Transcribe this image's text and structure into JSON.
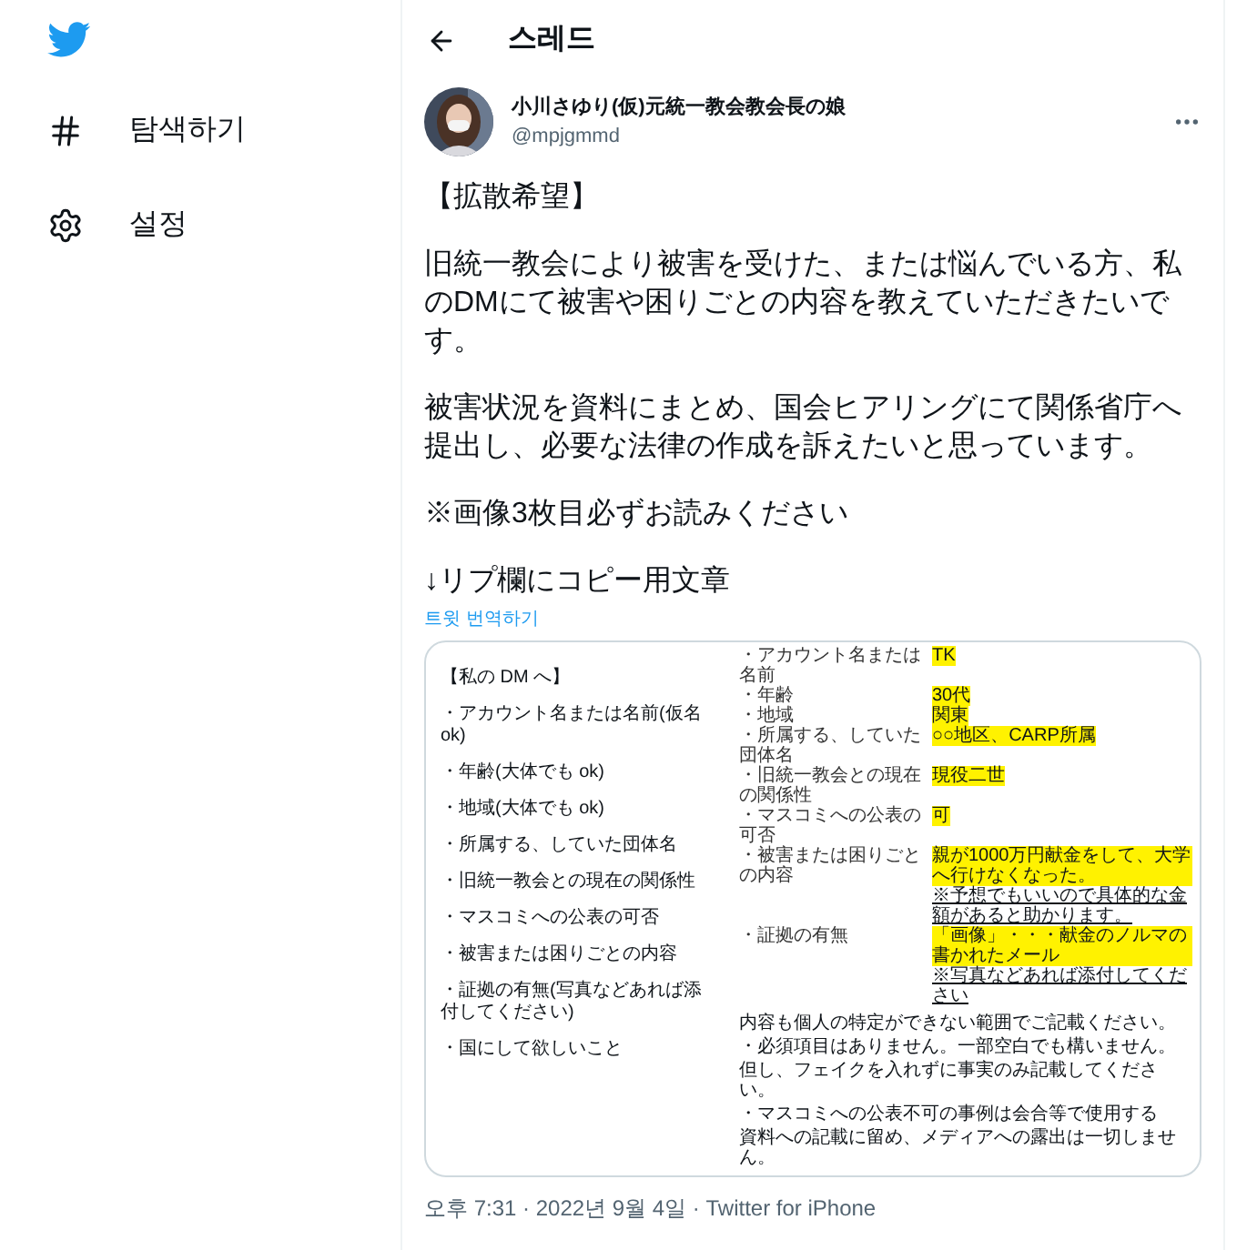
{
  "sidebar": {
    "items": [
      {
        "kind": "explore",
        "label": "탐색하기"
      },
      {
        "kind": "settings",
        "label": "설정"
      }
    ]
  },
  "header": {
    "title": "스레드"
  },
  "tweet": {
    "author": {
      "name": "小川さゆり(仮)元統一教会教会長の娘",
      "handle": "@mpjgmmd"
    },
    "paragraphs": [
      "【拡散希望】",
      "旧統一教会により被害を受けた、または悩んでいる方、私のDMにて被害や困りごとの内容を教えていただきたいです。",
      "被害状況を資料にまとめ、国会ヒアリングにて関係省庁へ提出し、必要な法律の作成を訴えたいと思っています。",
      "※画像3枚目必ずお読みください",
      "↓リプ欄にコピー用文章"
    ],
    "translate_link": "트윗 번역하기",
    "images": {
      "left": {
        "heading": "【私の DM へ】",
        "items": [
          "・アカウント名または名前(仮名 ok)",
          "・年齢(大体でも ok)",
          "・地域(大体でも ok)",
          "・所属する、していた団体名",
          "・旧統一教会との現在の関係性",
          "・マスコミへの公表の可否",
          "・被害または困りごとの内容",
          "・証拠の有無(写真などあれば添付してください)",
          "・国にして欲しいこと"
        ]
      },
      "right": {
        "rows": [
          {
            "label": "・アカウント名または名前",
            "value": "TK"
          },
          {
            "label": "・年齢",
            "value": "30代"
          },
          {
            "label": "・地域",
            "value": "関東"
          },
          {
            "label": "・所属する、していた団体名",
            "value": "○○地区、CARP所属"
          },
          {
            "label": "・旧統一教会との現在の関係性",
            "value": "現役二世"
          },
          {
            "label": "・マスコミへの公表の可否",
            "value": "可"
          },
          {
            "label": "・被害または困りごとの内容",
            "value": "親が1000万円献金をして、大学へ行けなくなった。",
            "note": "※予想でもいいので具体的な金額があると助かります。"
          },
          {
            "label": "・証拠の有無",
            "value": "「画像」・・・献金のノルマの書かれたメール",
            "note": "※写真などあれば添付してください"
          }
        ],
        "lines": [
          "内容も個人の特定ができない範囲でご記載ください。",
          "・必須項目はありません。一部空白でも構いません。",
          "但し、フェイクを入れずに事実のみ記載してください。",
          "・マスコミへの公表不可の事例は会合等で使用する",
          "資料への記載に留め、メディアへの露出は一切しません。"
        ]
      }
    },
    "meta": "오후 7:31 · 2022년 9월 4일 · Twitter for iPhone"
  }
}
